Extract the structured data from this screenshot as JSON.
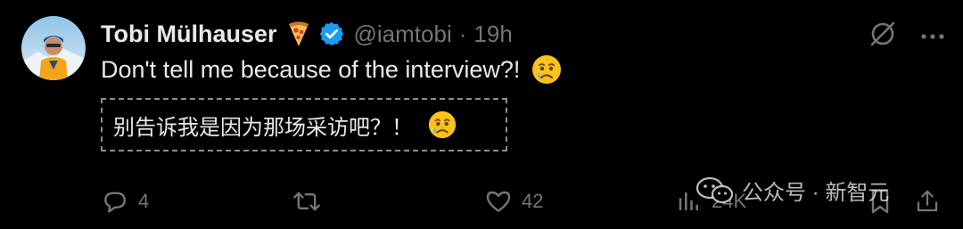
{
  "tweet": {
    "author_name": "Tobi Mülhauser",
    "handle": "@iamtobi",
    "separator": "·",
    "time_ago": "19h",
    "text": "Don't tell me because of the interview?!",
    "translation": "别告诉我是因为那场采访吧？！",
    "icons": {
      "name_emoji": "pizza-icon",
      "verified": "verified-badge-icon",
      "grok": "grok-icon",
      "more": "more-icon",
      "emoji": "crying-face-icon"
    }
  },
  "actions": {
    "reply_count": "4",
    "retweet_count": "",
    "like_count": "42",
    "views_count": "24K"
  },
  "watermark": {
    "text": "公众号 · 新智元"
  },
  "colors": {
    "background": "#000000",
    "text": "#e7e9ea",
    "muted": "#71767b",
    "verified": "#1d9bf0"
  }
}
